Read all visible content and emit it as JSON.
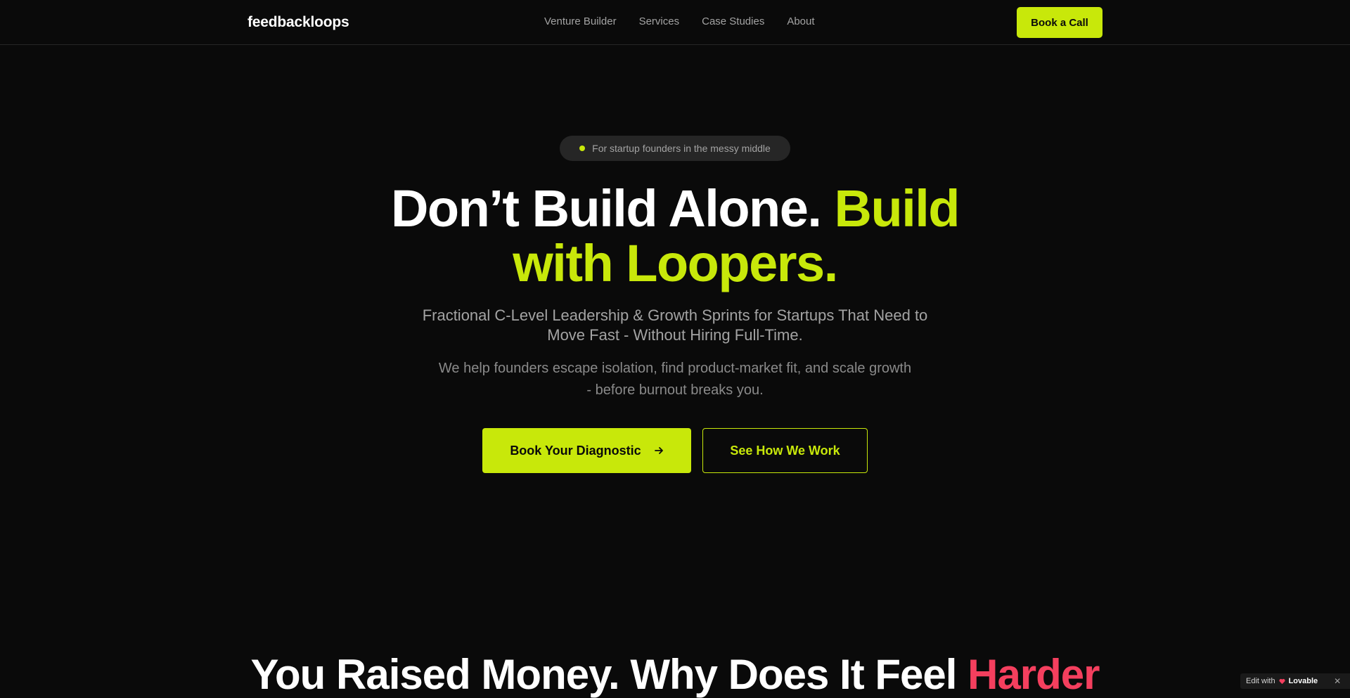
{
  "navbar": {
    "logo": "feedbackloops",
    "links": [
      "Venture Builder",
      "Services",
      "Case Studies",
      "About"
    ],
    "cta_label": "Book a Call"
  },
  "hero": {
    "pill_text": "For startup founders in the messy middle",
    "title_white": "Don’t Build Alone.",
    "title_accent_1": "Build",
    "title_accent_2": "with Loopers.",
    "subtitle": "Fractional C-Level Leadership & Growth Sprints for Startups That Need to Move Fast - Without Hiring Full-Time.",
    "description": "We help founders escape isolation, find product-market fit, and scale growth - before burnout breaks you.",
    "primary_cta": "Book Your Diagnostic",
    "secondary_cta": "See How We Work"
  },
  "section2": {
    "title_white": "You Raised Money. Why Does It Feel",
    "title_accent": "Harder"
  },
  "badge": {
    "prefix": "Edit with",
    "brand": "Lovable",
    "close_glyph": "✕"
  },
  "colors": {
    "background": "#0a0a0a",
    "accent": "#c8e80a",
    "highlight_red": "#f43f5e",
    "muted_text": "#a3a3a3"
  }
}
